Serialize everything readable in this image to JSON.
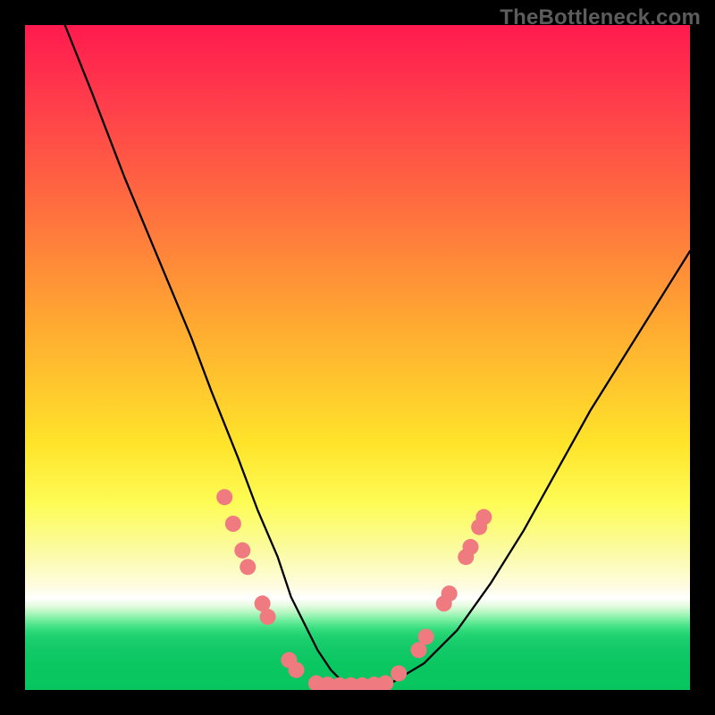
{
  "watermark": "TheBottleneck.com",
  "chart_data": {
    "type": "line",
    "title": "",
    "xlabel": "",
    "ylabel": "",
    "xlim": [
      0,
      100
    ],
    "ylim": [
      0,
      100
    ],
    "axes_visible": false,
    "background": "rainbow-vertical-gradient",
    "series": [
      {
        "name": "bottleneck-curve",
        "color": "#000000",
        "x": [
          6,
          10,
          15,
          20,
          25,
          28,
          32,
          35,
          38,
          40,
          42,
          44,
          46,
          48,
          50,
          55,
          60,
          65,
          70,
          75,
          80,
          85,
          90,
          95,
          100
        ],
        "y": [
          100,
          90,
          77,
          65,
          53,
          45,
          35,
          27,
          20,
          14,
          10,
          6,
          3,
          1,
          0.5,
          1,
          4,
          9,
          16,
          24,
          33,
          42,
          50,
          58,
          66
        ]
      }
    ],
    "dots": {
      "color": "#ef7a7f",
      "radius_px": 9,
      "points": [
        {
          "x": 30.0,
          "y": 29.0
        },
        {
          "x": 31.3,
          "y": 25.0
        },
        {
          "x": 32.7,
          "y": 21.0
        },
        {
          "x": 33.5,
          "y": 18.5
        },
        {
          "x": 35.7,
          "y": 13.0
        },
        {
          "x": 36.5,
          "y": 11.0
        },
        {
          "x": 39.7,
          "y": 4.5
        },
        {
          "x": 40.8,
          "y": 3.0
        },
        {
          "x": 43.8,
          "y": 1.0
        },
        {
          "x": 45.5,
          "y": 0.8
        },
        {
          "x": 47.3,
          "y": 0.7
        },
        {
          "x": 49.0,
          "y": 0.7
        },
        {
          "x": 50.7,
          "y": 0.7
        },
        {
          "x": 52.5,
          "y": 0.8
        },
        {
          "x": 54.2,
          "y": 1.0
        },
        {
          "x": 56.2,
          "y": 2.5
        },
        {
          "x": 59.2,
          "y": 6.0
        },
        {
          "x": 60.3,
          "y": 8.0
        },
        {
          "x": 63.0,
          "y": 13.0
        },
        {
          "x": 63.8,
          "y": 14.5
        },
        {
          "x": 66.3,
          "y": 20.0
        },
        {
          "x": 67.0,
          "y": 21.5
        },
        {
          "x": 68.3,
          "y": 24.5
        },
        {
          "x": 69.0,
          "y": 26.0
        }
      ]
    }
  }
}
